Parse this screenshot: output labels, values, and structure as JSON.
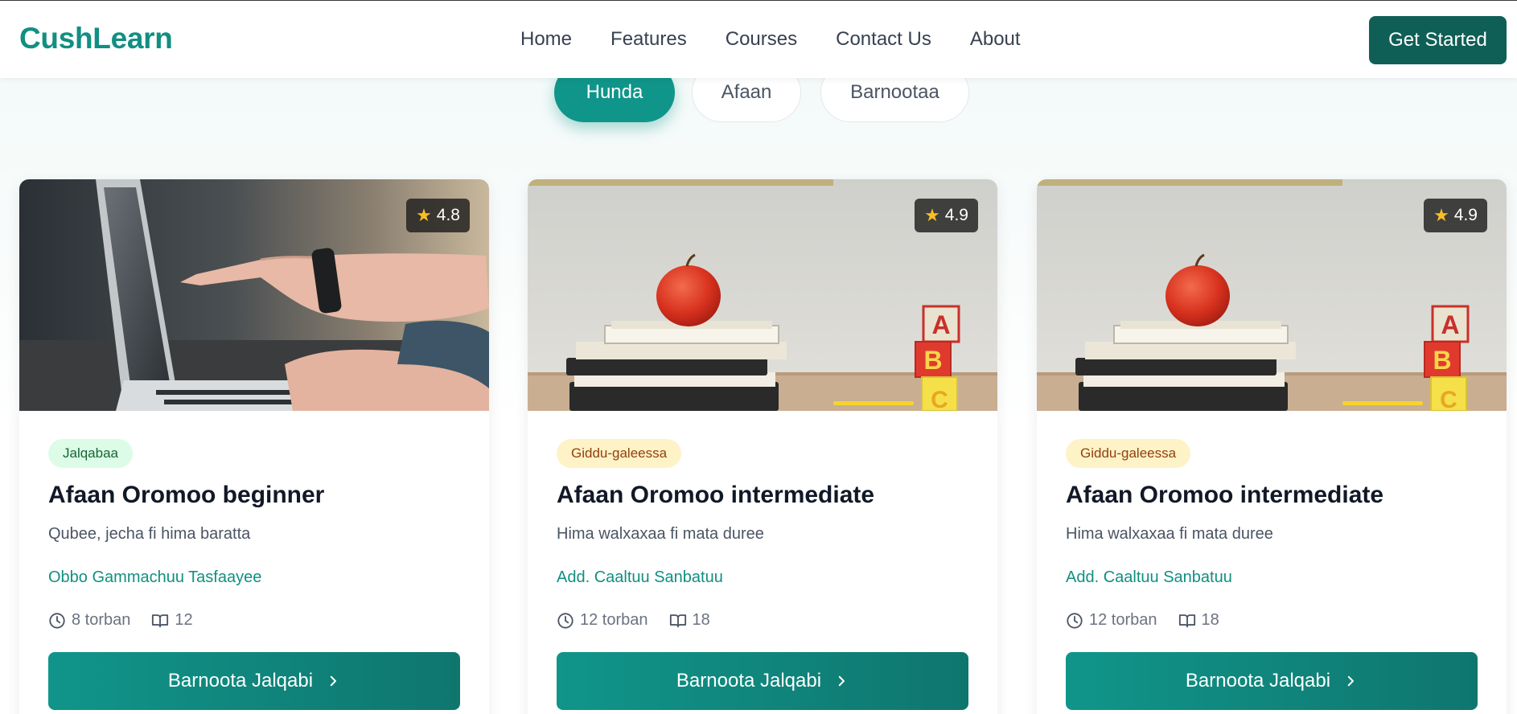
{
  "header": {
    "logo": "CushLearn",
    "nav": [
      "Home",
      "Features",
      "Courses",
      "Contact Us",
      "About"
    ],
    "cta": "Get Started"
  },
  "filters": [
    {
      "label": "Hunda",
      "active": true
    },
    {
      "label": "Afaan",
      "active": false
    },
    {
      "label": "Barnootaa",
      "active": false
    }
  ],
  "courses": [
    {
      "rating": "4.8",
      "level": "Jalqabaa",
      "title": "Afaan Oromoo beginner",
      "description": "Qubee, jecha fi hima baratta",
      "instructor": "Obbo Gammachuu Tasfaayee",
      "duration": "8 torban",
      "lessons": "12",
      "button": "Barnoota Jalqabi",
      "image": "laptop-photo"
    },
    {
      "rating": "4.9",
      "level": "Giddu-galeessa",
      "title": "Afaan Oromoo intermediate",
      "description": "Hima walxaxaa fi mata duree",
      "instructor": "Add. Caaltuu Sanbatuu",
      "duration": "12 torban",
      "lessons": "18",
      "button": "Barnoota Jalqabi",
      "image": "apple-books-photo"
    },
    {
      "rating": "4.9",
      "level": "Giddu-galeessa",
      "title": "Afaan Oromoo intermediate",
      "description": "Hima walxaxaa fi mata duree",
      "instructor": "Add. Caaltuu Sanbatuu",
      "duration": "12 torban",
      "lessons": "18",
      "button": "Barnoota Jalqabi",
      "image": "apple-books-photo"
    }
  ],
  "colors": {
    "brand": "#118f82",
    "cta_dark": "#0f5f56",
    "badge_beginner_bg": "#dcfce7",
    "badge_intermediate_bg": "#fef3c7",
    "star": "#fbbf24"
  },
  "icons": {
    "rating": "star-icon",
    "duration": "clock-icon",
    "lessons": "book-icon",
    "button": "chevron-right-icon"
  }
}
